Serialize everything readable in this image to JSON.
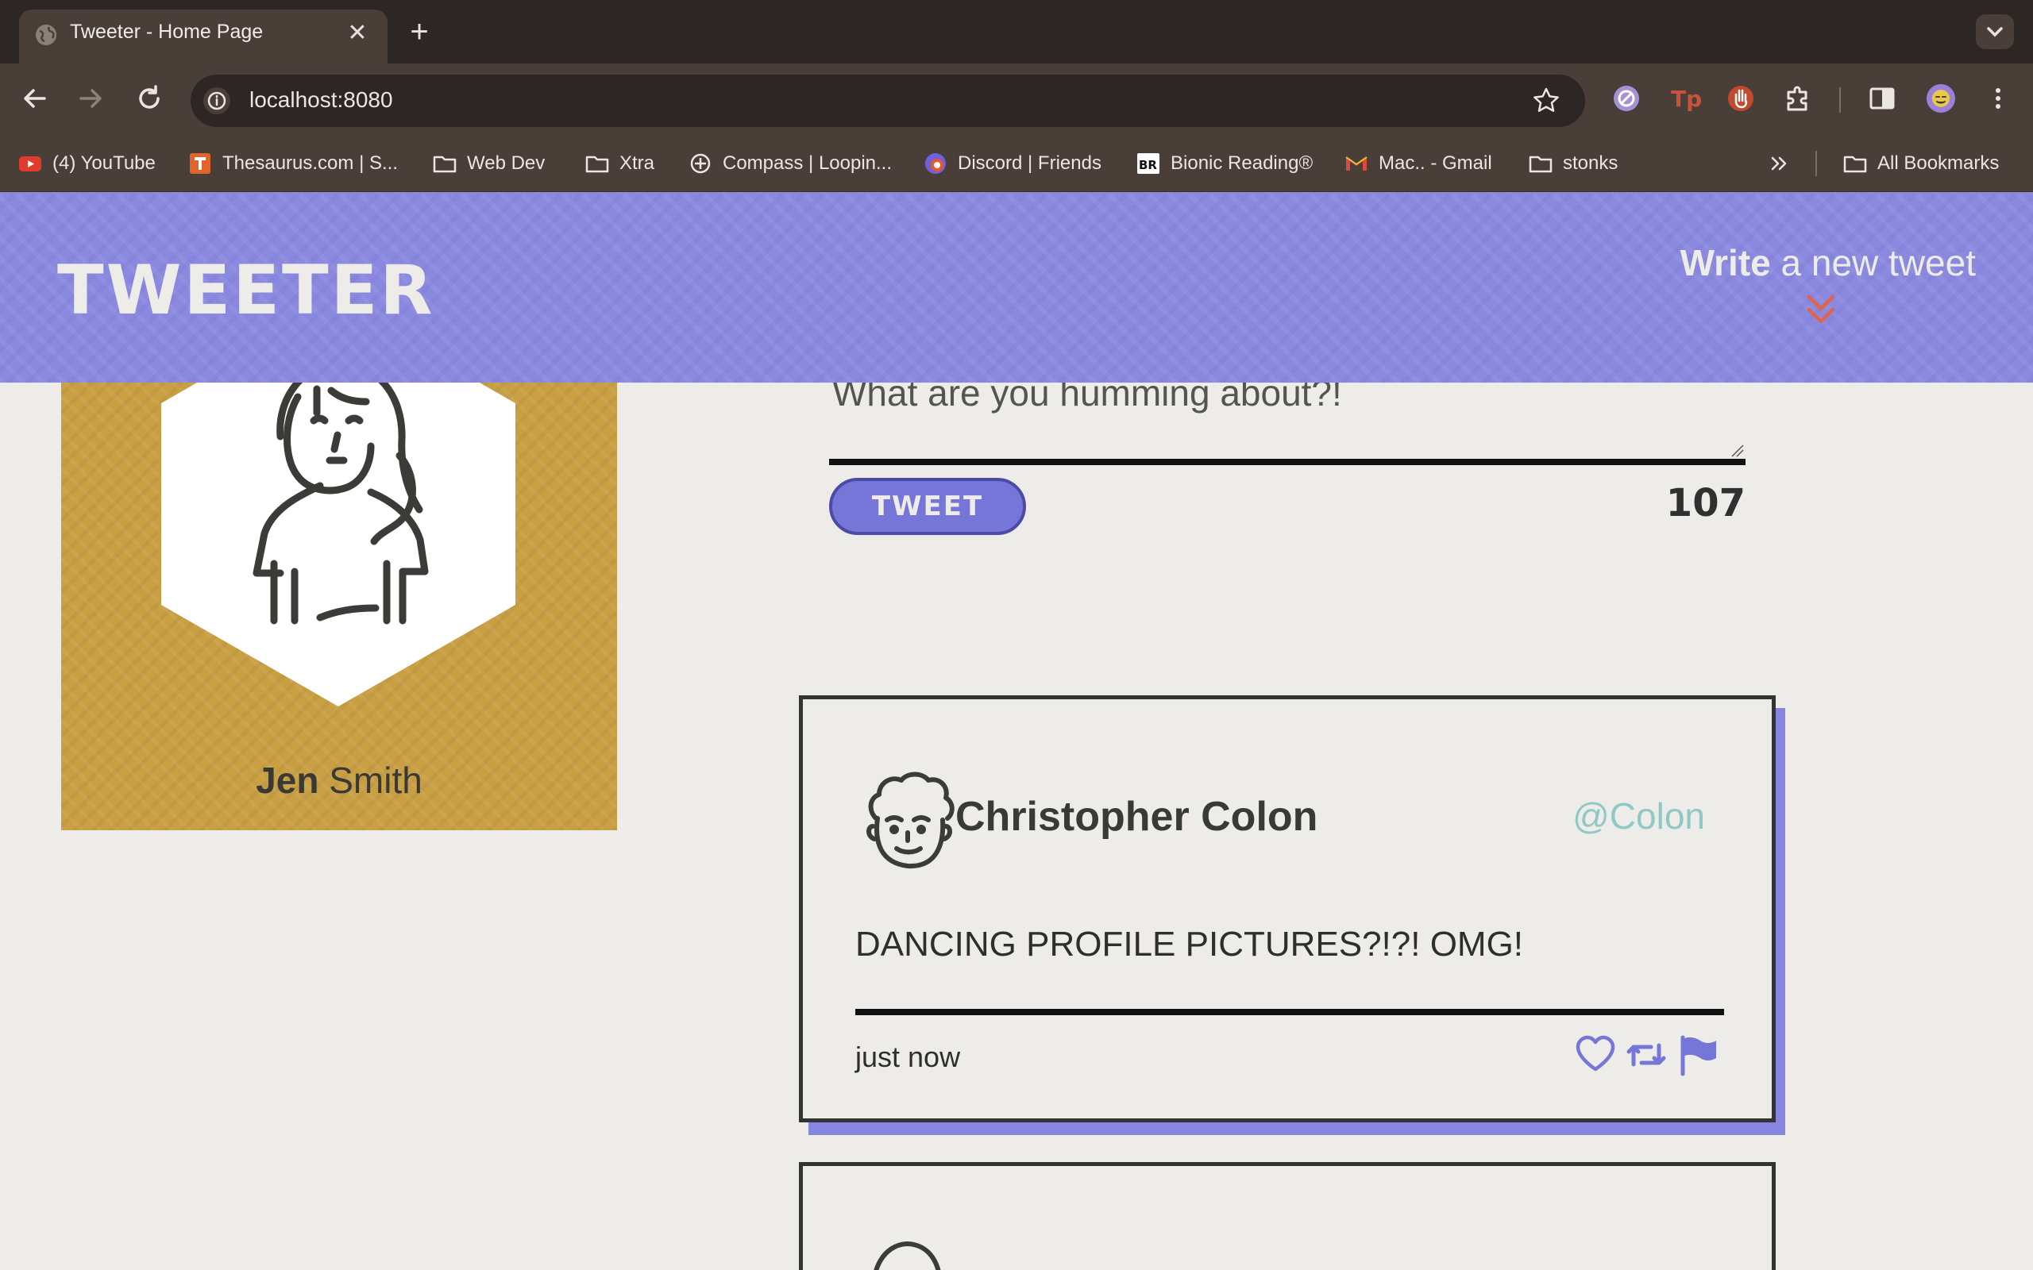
{
  "browser": {
    "tab_title": "Tweeter - Home Page",
    "url": "localhost:8080",
    "bookmarks": [
      {
        "label": "(4) YouTube",
        "icon": "youtube-icon"
      },
      {
        "label": "Thesaurus.com | S...",
        "icon": "thesaurus-icon"
      },
      {
        "label": "Web Dev",
        "icon": "folder-icon"
      },
      {
        "label": "Xtra",
        "icon": "folder-icon"
      },
      {
        "label": "Compass | Loopin...",
        "icon": "compass-icon"
      },
      {
        "label": "Discord | Friends",
        "icon": "discord-icon"
      },
      {
        "label": "Bionic Reading®",
        "icon": "bionic-reading-icon"
      },
      {
        "label": "Mac.. - Gmail",
        "icon": "gmail-icon"
      },
      {
        "label": "stonks",
        "icon": "folder-icon"
      }
    ],
    "all_bookmarks": "All Bookmarks",
    "colors": {
      "tabbar": "#2c2724",
      "toolbar": "#4a3e39"
    }
  },
  "header": {
    "logo": "TWEETER",
    "write_bold": "Write",
    "write_rest": "a new tweet",
    "color": "#8a89df",
    "accent": "#e0634c"
  },
  "profile": {
    "first_name": "Jen",
    "last_name": "Smith",
    "card_color": "#c99f43"
  },
  "compose": {
    "text": "What are you humming about?!",
    "button": "TWEET",
    "counter": "107"
  },
  "tweets": [
    {
      "name": "Christopher Colon",
      "handle": "@Colon",
      "body": "DANCING PROFILE PICTURES?!?! OMG!",
      "time": "just now",
      "actions": [
        "heart-icon",
        "retweet-icon",
        "flag-icon"
      ]
    }
  ]
}
